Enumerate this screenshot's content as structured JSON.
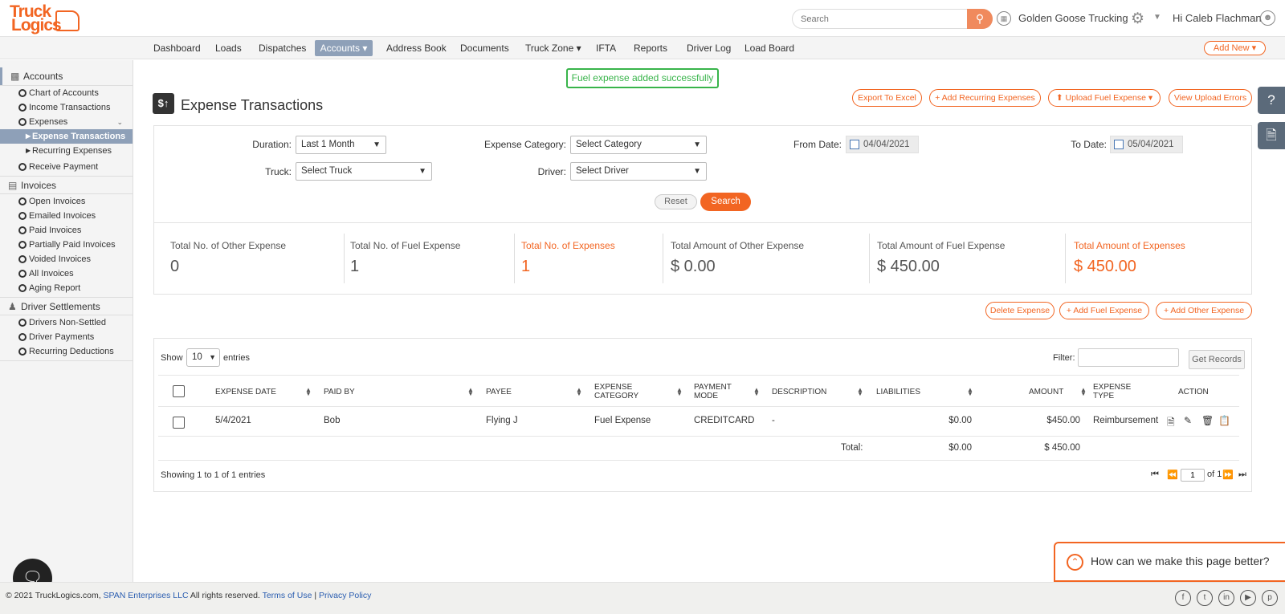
{
  "header": {
    "logo_line1": "Truck",
    "logo_line2": "Logics",
    "search_placeholder": "Search",
    "company_name": "Golden Goose Trucking",
    "greeting": "Hi Caleb Flachman"
  },
  "nav": {
    "items": [
      "Dashboard",
      "Loads",
      "Dispatches",
      "Accounts ▾",
      "Address Book",
      "Documents",
      "Truck Zone ▾",
      "IFTA",
      "Reports",
      "Driver Log",
      "Load Board"
    ],
    "add_new": "Add New ▾"
  },
  "sidebar": {
    "accounts_head": "Accounts",
    "accounts_items": [
      "Chart of Accounts",
      "Income Transactions",
      "Expenses"
    ],
    "expense_subs": [
      "Expense Transactions",
      "Recurring Expenses"
    ],
    "receive_payment": "Receive Payment",
    "invoices_head": "Invoices",
    "invoice_items": [
      "Open Invoices",
      "Emailed Invoices",
      "Paid Invoices",
      "Partially Paid Invoices",
      "Voided Invoices",
      "All Invoices",
      "Aging Report"
    ],
    "settlements_head": "Driver Settlements",
    "settlement_items": [
      "Drivers Non-Settled",
      "Driver Payments",
      "Recurring Deductions"
    ]
  },
  "toast": "Fuel expense added successfully",
  "page": {
    "title": "Expense Transactions",
    "icon_text": "$↑"
  },
  "top_actions": {
    "export": "Export To Excel",
    "add_recurring": "+ Add Recurring Expenses",
    "upload_fuel": "⬆ Upload Fuel Expense  ▾",
    "view_errors": "View Upload Errors"
  },
  "filters": {
    "duration_label": "Duration:",
    "duration_value": "Last 1 Month",
    "category_label": "Expense Category:",
    "category_value": "Select Category",
    "from_label": "From Date:",
    "from_value": "04/04/2021",
    "to_label": "To Date:",
    "to_value": "05/04/2021",
    "truck_label": "Truck:",
    "truck_value": "Select Truck",
    "driver_label": "Driver:",
    "driver_value": "Select Driver",
    "reset": "Reset",
    "search": "Search"
  },
  "stats": [
    {
      "label": "Total No. of Other Expense",
      "value": "0"
    },
    {
      "label": "Total No. of Fuel Expense",
      "value": "1"
    },
    {
      "label": "Total No. of Expenses",
      "value": "1"
    },
    {
      "label": "Total Amount of Other Expense",
      "value": "$ 0.00"
    },
    {
      "label": "Total Amount of Fuel Expense",
      "value": "$ 450.00"
    },
    {
      "label": "Total Amount of Expenses",
      "value": "$ 450.00"
    }
  ],
  "expense_actions": {
    "delete": "Delete Expense",
    "add_fuel": "+ Add Fuel Expense",
    "add_other": "+ Add Other Expense"
  },
  "table": {
    "show_label": "Show",
    "show_value": "10",
    "entries_label": "entries",
    "filter_label": "Filter:",
    "get_records": "Get Records",
    "headers": {
      "date": "EXPENSE DATE",
      "paid_by": "PAID BY",
      "payee": "PAYEE",
      "category_1": "EXPENSE",
      "category_2": "CATEGORY",
      "mode_1": "PAYMENT",
      "mode_2": "MODE",
      "description": "DESCRIPTION",
      "liabilities": "LIABILITIES",
      "amount": "AMOUNT",
      "type_1": "EXPENSE",
      "type_2": "TYPE",
      "action": "ACTION"
    },
    "rows": [
      {
        "date": "5/4/2021",
        "paid_by": "Bob",
        "payee": "Flying J",
        "category": "Fuel Expense",
        "mode": "CREDITCARD",
        "description": "-",
        "liabilities": "$0.00",
        "amount": "$450.00",
        "type": "Reimbursement"
      }
    ],
    "total_label": "Total:",
    "total_liabilities": "$0.00",
    "total_amount": "$ 450.00",
    "showing": "Showing 1 to 1 of 1 entries",
    "page_value": "1",
    "page_of": "of 1"
  },
  "feedback": "How can we make this page better?",
  "footer": {
    "prefix": "© 2021 TruckLogics.com,",
    "company_link": "SPAN Enterprises LLC",
    "rights": "All rights reserved.",
    "terms": "Terms of Use",
    "sep": "|",
    "privacy": "Privacy Policy"
  },
  "colors": {
    "brand_orange": "#f26522",
    "success_green": "#38b44a",
    "nav_active": "#8ea0b8"
  }
}
